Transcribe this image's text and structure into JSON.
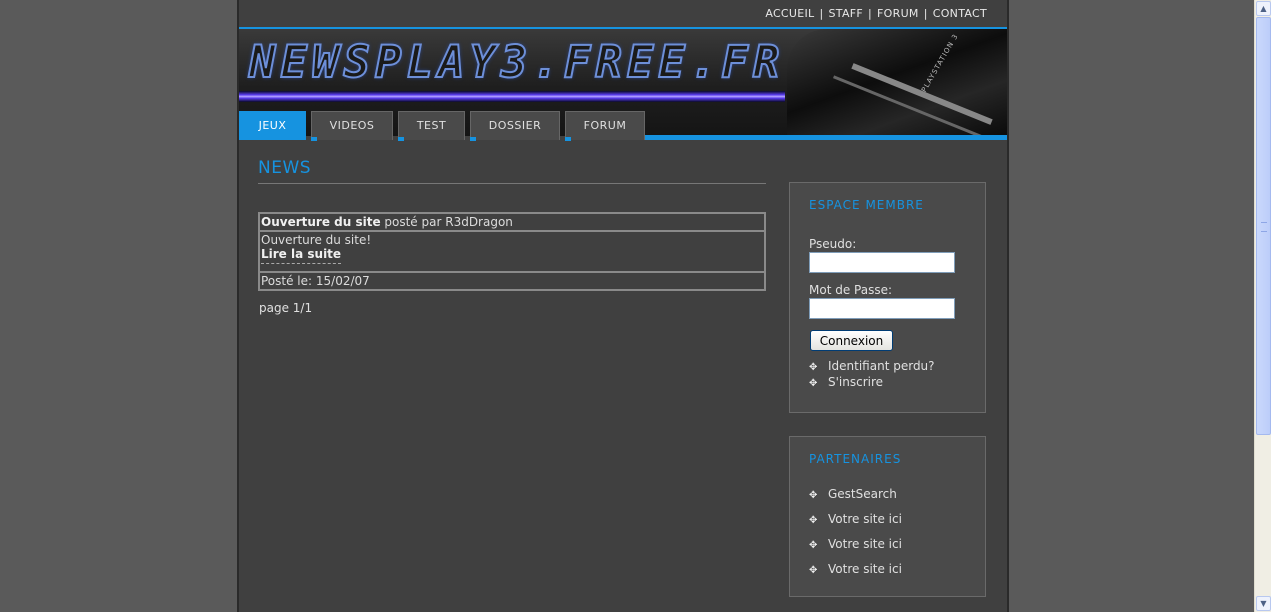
{
  "toplinks": [
    "ACCUEIL",
    "STAFF",
    "FORUM",
    "CONTACT"
  ],
  "toplinks_sep": "|",
  "banner": {
    "logo_text": "NEWSPLAY3.FREE.FR",
    "console_brand": "PLAYSTATION 3"
  },
  "nav": {
    "tabs": [
      "JEUX",
      "VIDEOS",
      "TEST",
      "DOSSIER",
      "FORUM"
    ],
    "active": "JEUX"
  },
  "main": {
    "title": "NEWS",
    "news": {
      "title": "Ouverture du site",
      "byline": " posté par R3dDragon",
      "body": "Ouverture du site!",
      "more": "Lire la suite",
      "date": "Posté le: 15/02/07"
    },
    "pager": "page 1/1"
  },
  "member": {
    "title": "ESPACE MEMBRE",
    "pseudo_label": "Pseudo:",
    "password_label": "Mot de Passe:",
    "pseudo_value": "",
    "password_value": "",
    "button": "Connexion",
    "links": [
      "Identifiant perdu?",
      "S'inscrire"
    ]
  },
  "partners": {
    "title": "PARTENAIRES",
    "links": [
      "GestSearch",
      "Votre site ici",
      "Votre site ici",
      "Votre site ici"
    ]
  },
  "bullet_glyph": "✥",
  "colors": {
    "accent": "#1693e0",
    "page_bg": "#404040",
    "outer_bg": "#5a5a5a"
  },
  "scrollbar": {
    "up": "▲",
    "down": "▼"
  }
}
